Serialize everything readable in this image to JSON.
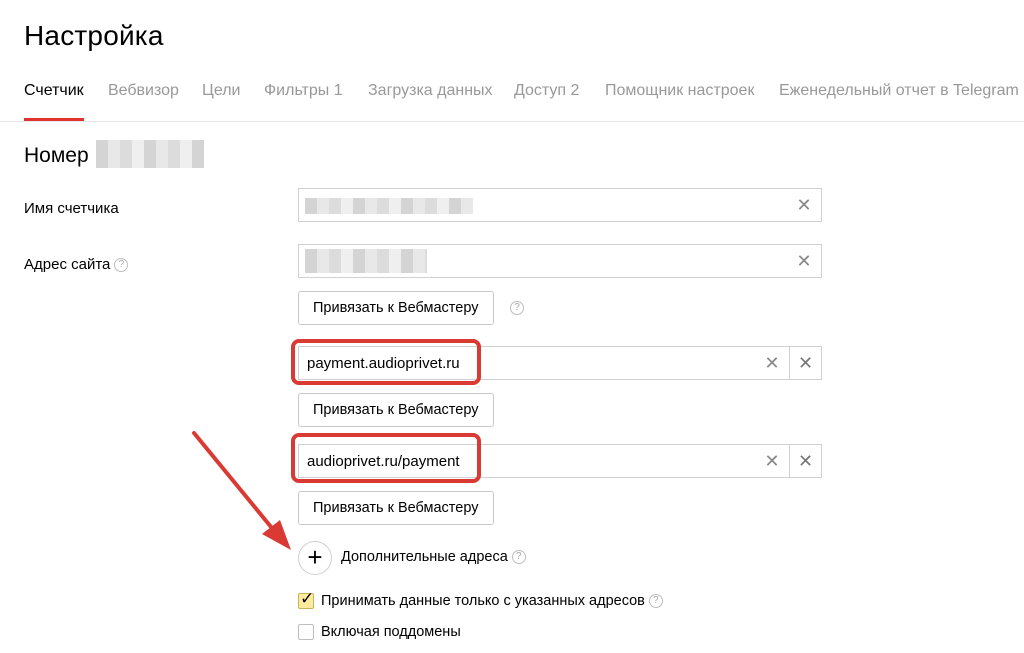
{
  "page": {
    "title": "Настройка"
  },
  "tabs": [
    {
      "label": "Счетчик",
      "active": true
    },
    {
      "label": "Вебвизор"
    },
    {
      "label": "Цели"
    },
    {
      "label": "Фильтры 1"
    },
    {
      "label": "Загрузка данных"
    },
    {
      "label": "Доступ 2"
    },
    {
      "label": "Помощник настроек"
    },
    {
      "label": "Еженедельный отчет в Telegram"
    }
  ],
  "counter": {
    "section_title": "Номер",
    "name_label": "Имя счетчика",
    "site_label": "Адрес сайта",
    "help_glyph": "?",
    "webmaster_button": "Привязать к Вебмастеру",
    "extra_url_1": "payment.audioprivet.ru",
    "extra_url_2": "audioprivet.ru/payment",
    "additional_addresses_label": "Дополнительные адреса",
    "accept_only_label": "Принимать данные только с указанных адресов",
    "accept_only_checked": true,
    "include_subdomains_label": "Включая поддомены",
    "include_subdomains_checked": false
  },
  "icons": {
    "clear": "close-icon",
    "remove": "close-icon",
    "add": "plus-icon",
    "help": "question-icon"
  },
  "colors": {
    "accent": "#e0332d",
    "annotation": "#d93a34",
    "checkbox_checked": "#ffeba0"
  }
}
